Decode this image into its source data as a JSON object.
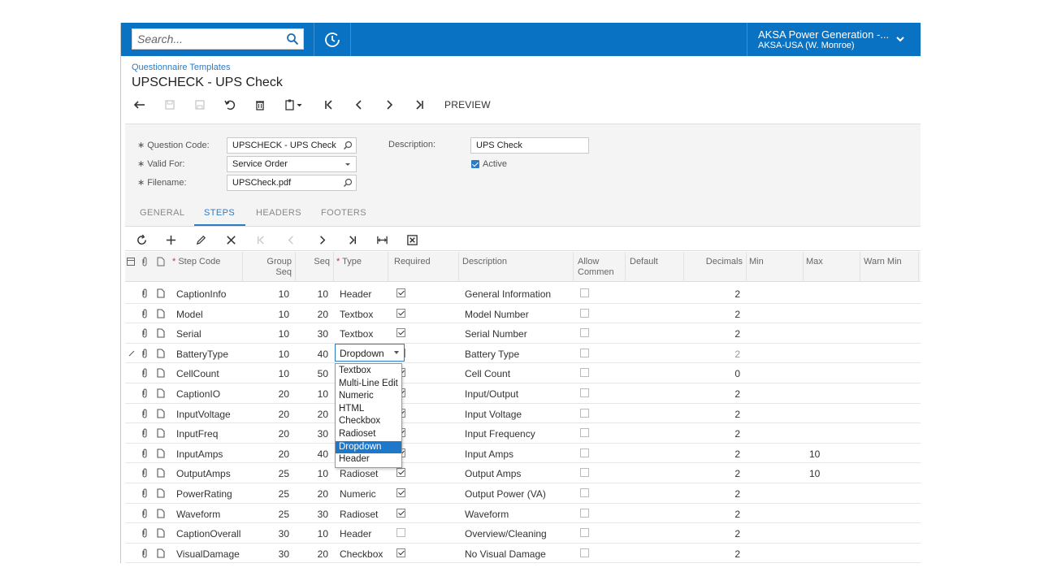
{
  "topbar": {
    "search_placeholder": "Search...",
    "tenant_line1": "AKSA Power Generation -...",
    "tenant_line2": "AKSA-USA (W. Monroe)"
  },
  "breadcrumb": "Questionnaire Templates",
  "title": "UPSCHECK - UPS Check",
  "toolbar": {
    "preview_label": "PREVIEW"
  },
  "form": {
    "question_code_label": "Question Code:",
    "question_code_value": "UPSCHECK - UPS Check",
    "valid_for_label": "Valid For:",
    "valid_for_value": "Service Order",
    "filename_label": "Filename:",
    "filename_value": "UPSCheck.pdf",
    "description_label": "Description:",
    "description_value": "UPS Check",
    "active_label": "Active",
    "active_checked": true
  },
  "tabs": [
    "GENERAL",
    "STEPS",
    "HEADERS",
    "FOOTERS"
  ],
  "active_tab": "STEPS",
  "grid": {
    "headers": {
      "step_code": "Step Code",
      "group_seq_1": "Group",
      "group_seq_2": "Seq",
      "seq": "Seq",
      "type": "Type",
      "required": "Required",
      "description": "Description",
      "allow_comment_1": "Allow",
      "allow_comment_2": "Commen",
      "default": "Default",
      "decimals": "Decimals",
      "min": "Min",
      "max": "Max",
      "warn_min": "Warn Min"
    },
    "rows": [
      {
        "code": "CaptionInfo",
        "group": "10",
        "seq": "10",
        "type": "Header",
        "required": true,
        "description": "General Information",
        "decimals": "2",
        "max": ""
      },
      {
        "code": "Model",
        "group": "10",
        "seq": "20",
        "type": "Textbox",
        "required": true,
        "description": "Model Number",
        "decimals": "2",
        "max": ""
      },
      {
        "code": "Serial",
        "group": "10",
        "seq": "30",
        "type": "Textbox",
        "required": true,
        "description": "Serial Number",
        "decimals": "2",
        "max": ""
      },
      {
        "code": "BatteryType",
        "group": "10",
        "seq": "40",
        "type": "Dropdown",
        "required": true,
        "description": "Battery Type",
        "decimals": "2",
        "max": ""
      },
      {
        "code": "CellCount",
        "group": "10",
        "seq": "50",
        "type": "",
        "required": true,
        "description": "Cell Count",
        "decimals": "0",
        "max": ""
      },
      {
        "code": "CaptionIO",
        "group": "20",
        "seq": "10",
        "type": "",
        "required": true,
        "description": "Input/Output",
        "decimals": "2",
        "max": ""
      },
      {
        "code": "InputVoltage",
        "group": "20",
        "seq": "20",
        "type": "",
        "required": true,
        "description": "Input Voltage",
        "decimals": "2",
        "max": ""
      },
      {
        "code": "InputFreq",
        "group": "20",
        "seq": "30",
        "type": "",
        "required": true,
        "description": "Input Frequency",
        "decimals": "2",
        "max": ""
      },
      {
        "code": "InputAmps",
        "group": "20",
        "seq": "40",
        "type": "",
        "required": true,
        "description": "Input Amps",
        "decimals": "2",
        "max": "10"
      },
      {
        "code": "OutputAmps",
        "group": "25",
        "seq": "10",
        "type": "Radioset",
        "required": true,
        "description": "Output Amps",
        "decimals": "2",
        "max": "10"
      },
      {
        "code": "PowerRating",
        "group": "25",
        "seq": "20",
        "type": "Numeric",
        "required": true,
        "description": "Output Power (VA)",
        "decimals": "2",
        "max": ""
      },
      {
        "code": "Waveform",
        "group": "25",
        "seq": "30",
        "type": "Radioset",
        "required": true,
        "description": "Waveform",
        "decimals": "2",
        "max": ""
      },
      {
        "code": "CaptionOverall",
        "group": "30",
        "seq": "10",
        "type": "Header",
        "required": false,
        "description": "Overview/Cleaning",
        "decimals": "2",
        "max": ""
      },
      {
        "code": "VisualDamage",
        "group": "30",
        "seq": "20",
        "type": "Checkbox",
        "required": true,
        "description": "No Visual Damage",
        "decimals": "2",
        "max": ""
      }
    ]
  },
  "type_dropdown": {
    "value": "Dropdown",
    "options": [
      "Textbox",
      "Multi-Line Edit",
      "Numeric",
      "HTML",
      "Checkbox",
      "Radioset",
      "Dropdown",
      "Header"
    ],
    "selected": "Dropdown"
  },
  "colors": {
    "topbar": "#0a72c3",
    "accent": "#2a7cc7",
    "selected_option": "#1e78c9"
  }
}
